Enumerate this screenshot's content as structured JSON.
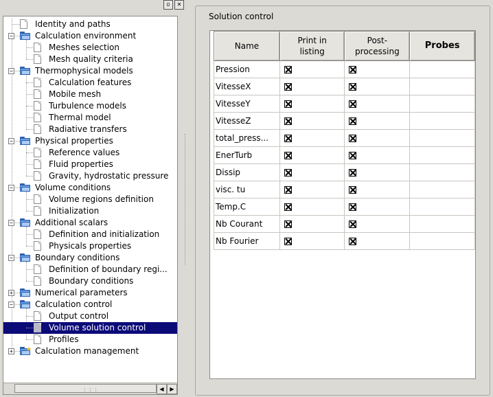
{
  "window": {
    "float_button_icon": "restore-icon",
    "close_button_icon": "close-icon"
  },
  "tree": {
    "items": [
      {
        "label": "Identity and paths",
        "level": 0,
        "type": "doc",
        "expander": "none"
      },
      {
        "label": "Calculation environment",
        "level": 0,
        "type": "folder",
        "expander": "minus"
      },
      {
        "label": "Meshes selection",
        "level": 1,
        "type": "doc"
      },
      {
        "label": "Mesh quality criteria",
        "level": 1,
        "type": "doc"
      },
      {
        "label": "Thermophysical models",
        "level": 0,
        "type": "folder",
        "expander": "minus"
      },
      {
        "label": "Calculation features",
        "level": 1,
        "type": "doc"
      },
      {
        "label": "Mobile mesh",
        "level": 1,
        "type": "doc"
      },
      {
        "label": "Turbulence models",
        "level": 1,
        "type": "doc"
      },
      {
        "label": "Thermal model",
        "level": 1,
        "type": "doc"
      },
      {
        "label": "Radiative transfers",
        "level": 1,
        "type": "doc"
      },
      {
        "label": "Physical properties",
        "level": 0,
        "type": "folder",
        "expander": "minus"
      },
      {
        "label": "Reference values",
        "level": 1,
        "type": "doc"
      },
      {
        "label": "Fluid properties",
        "level": 1,
        "type": "doc"
      },
      {
        "label": "Gravity, hydrostatic pressure",
        "level": 1,
        "type": "doc"
      },
      {
        "label": "Volume conditions",
        "level": 0,
        "type": "folder",
        "expander": "minus"
      },
      {
        "label": "Volume regions definition",
        "level": 1,
        "type": "doc"
      },
      {
        "label": "Initialization",
        "level": 1,
        "type": "doc"
      },
      {
        "label": "Additional scalars",
        "level": 0,
        "type": "folder",
        "expander": "minus"
      },
      {
        "label": "Definition and initialization",
        "level": 1,
        "type": "doc"
      },
      {
        "label": "Physicals properties",
        "level": 1,
        "type": "doc"
      },
      {
        "label": "Boundary conditions",
        "level": 0,
        "type": "folder",
        "expander": "minus"
      },
      {
        "label": "Definition of boundary regi...",
        "level": 1,
        "type": "doc"
      },
      {
        "label": "Boundary conditions",
        "level": 1,
        "type": "doc"
      },
      {
        "label": "Numerical parameters",
        "level": 0,
        "type": "folder",
        "expander": "plus"
      },
      {
        "label": "Calculation control",
        "level": 0,
        "type": "folder",
        "expander": "minus"
      },
      {
        "label": "Output control",
        "level": 1,
        "type": "doc"
      },
      {
        "label": "Volume solution control",
        "level": 1,
        "type": "doc",
        "selected": true
      },
      {
        "label": "Profiles",
        "level": 1,
        "type": "doc"
      },
      {
        "label": "Calculation management",
        "level": 0,
        "type": "folder-star",
        "expander": "plus"
      }
    ]
  },
  "panel": {
    "title": "Solution control",
    "columns": [
      "Name",
      "Print in\nlisting",
      "Post-\nprocessing",
      "Probes"
    ],
    "rows": [
      {
        "name": "Pression",
        "print": true,
        "post": true,
        "probes": ""
      },
      {
        "name": "VitesseX",
        "print": true,
        "post": true,
        "probes": ""
      },
      {
        "name": "VitesseY",
        "print": true,
        "post": true,
        "probes": ""
      },
      {
        "name": "VitesseZ",
        "print": true,
        "post": true,
        "probes": ""
      },
      {
        "name": "total_press...",
        "print": true,
        "post": true,
        "probes": ""
      },
      {
        "name": "EnerTurb",
        "print": true,
        "post": true,
        "probes": ""
      },
      {
        "name": "Dissip",
        "print": true,
        "post": true,
        "probes": ""
      },
      {
        "name": "visc. tu",
        "print": true,
        "post": true,
        "probes": ""
      },
      {
        "name": "Temp.C",
        "print": true,
        "post": true,
        "probes": ""
      },
      {
        "name": "Nb Courant",
        "print": true,
        "post": true,
        "probes": ""
      },
      {
        "name": "Nb Fourier",
        "print": true,
        "post": true,
        "probes": ""
      }
    ]
  },
  "scrollbar": {
    "left_arrow": "◀",
    "right_arrow": "▶",
    "left_icon": "arrow-left-icon",
    "right_icon": "arrow-right-icon"
  }
}
